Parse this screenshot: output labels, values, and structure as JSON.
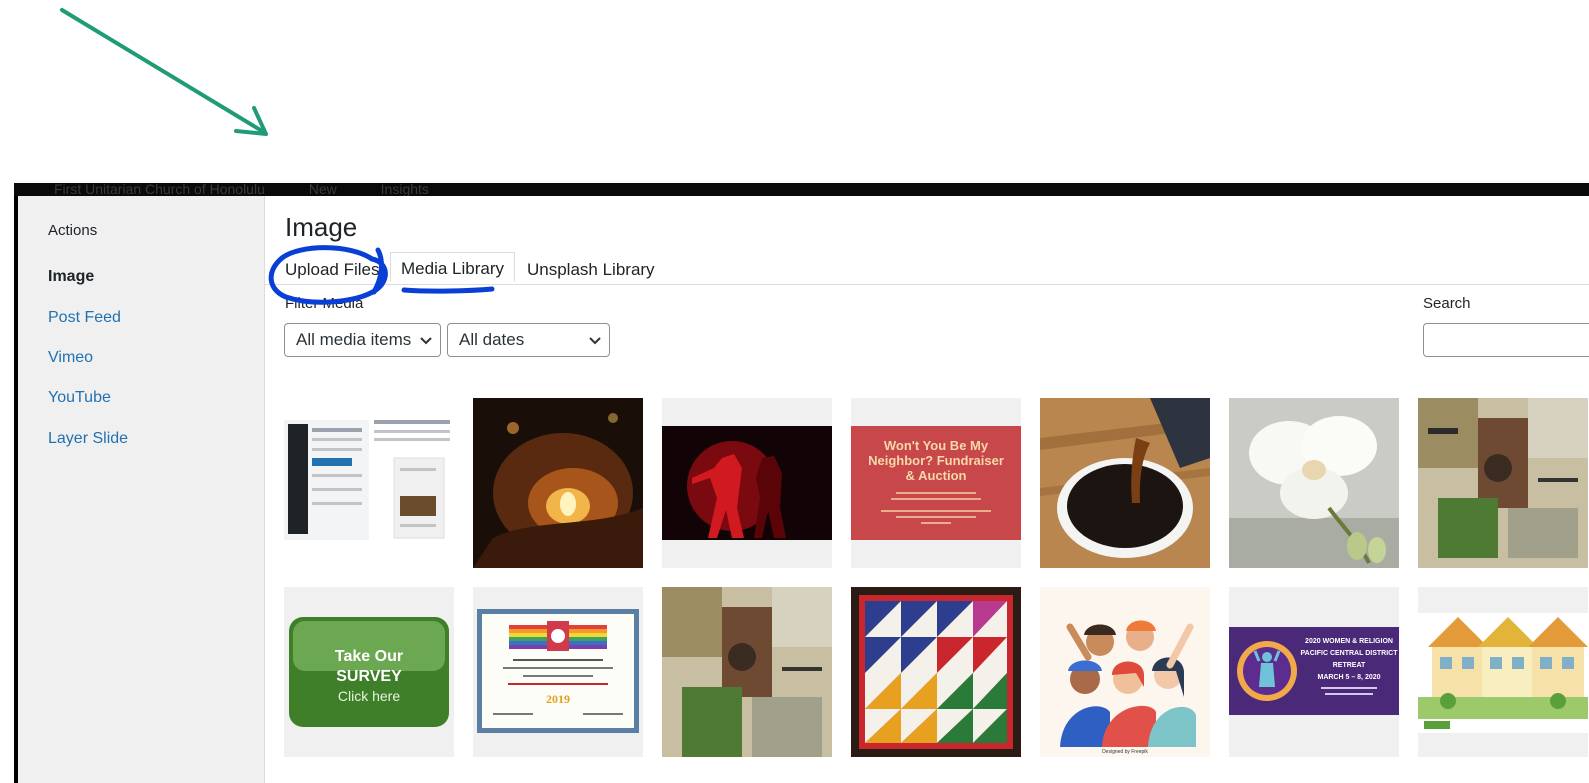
{
  "adminbar": {
    "site_name": "First Unitarian Church of Honolulu",
    "new_label": "New",
    "insights_label": "Insights"
  },
  "sidebar": {
    "heading": "Actions",
    "items": [
      {
        "label": "Image",
        "active": true
      },
      {
        "label": "Post Feed"
      },
      {
        "label": "Vimeo"
      },
      {
        "label": "YouTube"
      },
      {
        "label": "Layer Slide"
      }
    ]
  },
  "main": {
    "title": "Image",
    "tabs": [
      {
        "label": "Upload Files"
      },
      {
        "label": "Media Library",
        "active": true
      },
      {
        "label": "Unsplash Library"
      }
    ],
    "filter_label": "Filter Media",
    "type_filter": {
      "selected": "All media items"
    },
    "date_filter": {
      "selected": "All dates"
    },
    "search_label": "Search",
    "search_value": ""
  },
  "thumbnails": {
    "fundraiser": {
      "line1": "Won't You Be My",
      "line2": "Neighbor? Fundraiser",
      "line3": "& Auction"
    },
    "survey": {
      "line1": "Take Our",
      "line2": "SURVEY",
      "line3": "Click here"
    },
    "certificate": {
      "year": "2019"
    },
    "retreat": {
      "line1": "2020 WOMEN & RELIGION",
      "line2": "PACIFIC CENTRAL DISTRICT",
      "line3": "RETREAT",
      "line4": "MARCH 5 – 8, 2020"
    },
    "credit": "Designed by Freepik"
  },
  "colors": {
    "link": "#2271b1",
    "annotation_arrow": "#1f9b77",
    "annotation_marker": "#0a3fd6"
  }
}
